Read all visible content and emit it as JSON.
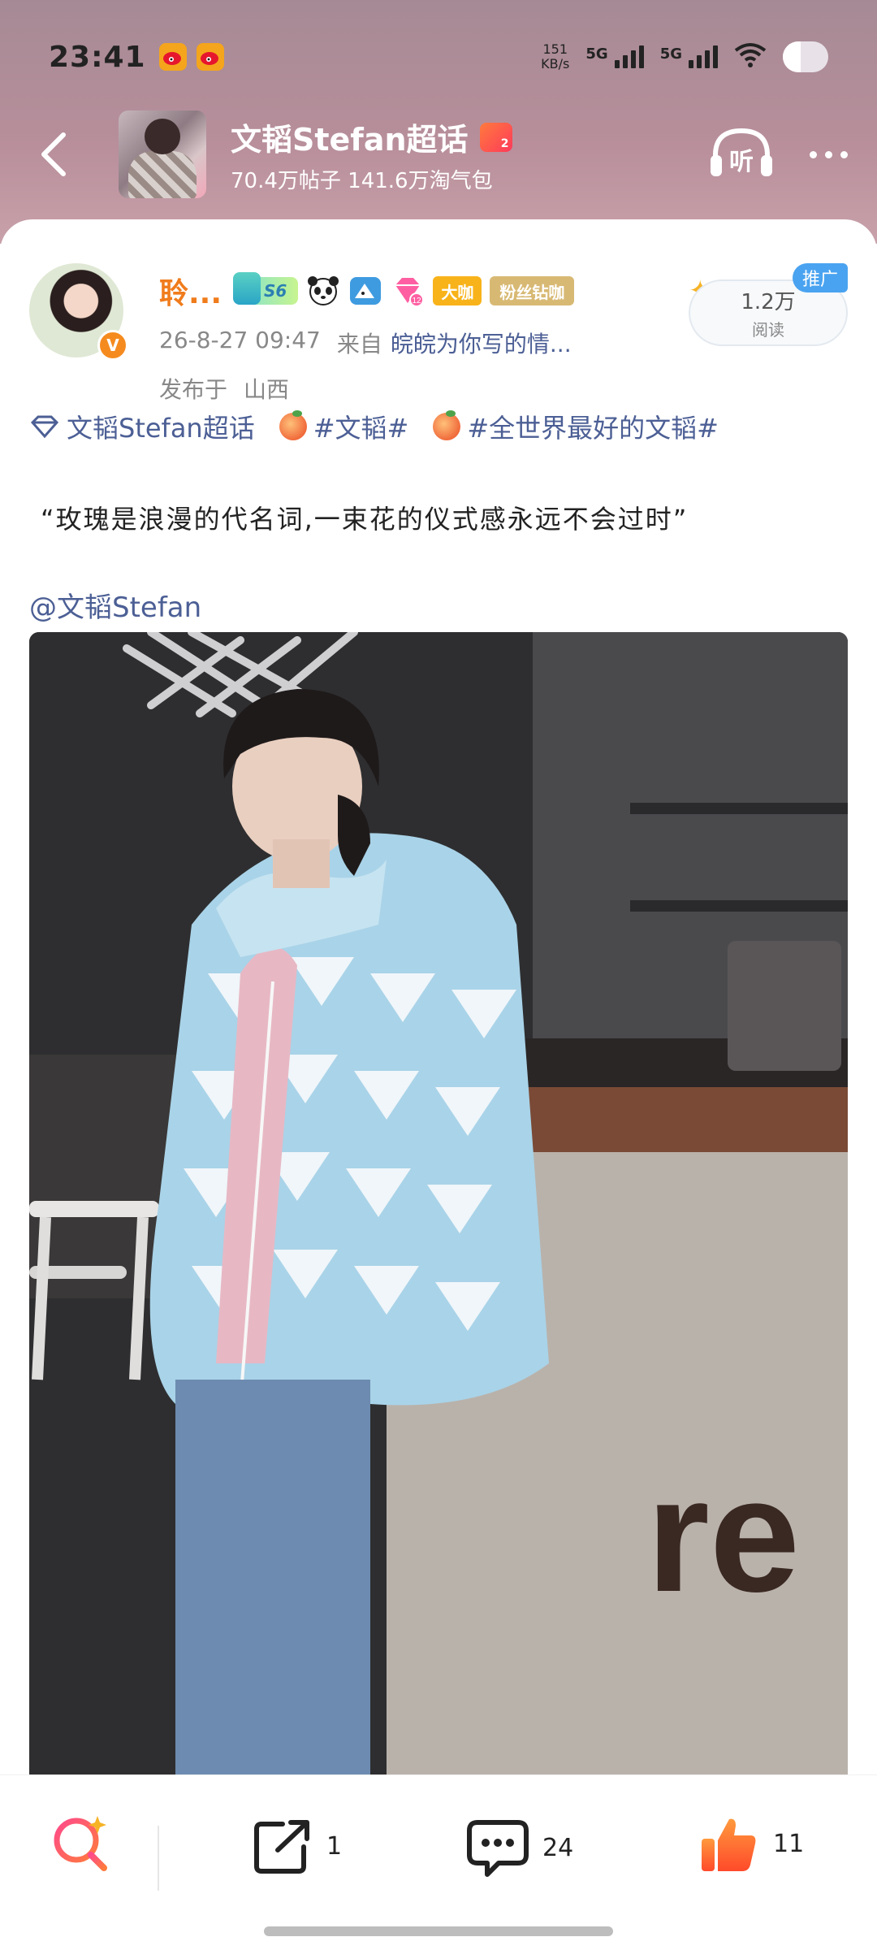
{
  "status_bar": {
    "time": "23:41",
    "net_speed_value": "151",
    "net_speed_unit": "KB/s",
    "signal1": "5G",
    "signal2": "5G",
    "notif_icons": [
      "weibo-icon",
      "weibo-icon"
    ]
  },
  "header": {
    "topic_title": "文韬Stefan超话",
    "topic_level": "2",
    "topic_stats": "70.4万帖子 141.6万淘气包",
    "listen_label": "听"
  },
  "post": {
    "username": "聆...",
    "badge_level": "S6",
    "badge_daka": "大咖",
    "badge_fan": "粉丝钻咖",
    "rank_badge_num": "12",
    "timestamp": "26-8-27 09:47",
    "source_prefix": "来自",
    "source_name": "皖皖为你写的情...",
    "location_prefix": "发布于",
    "location": "山西",
    "views_count": "1.2万",
    "views_label": "阅读",
    "promo_tag": "推广",
    "topic_links": [
      {
        "label": "文韬Stefan超话",
        "icon": "supertopic-diamond-icon"
      },
      {
        "label": "#文韬#",
        "icon": "peach-icon"
      },
      {
        "label": "#全世界最好的文韬#",
        "icon": "peach-icon"
      }
    ],
    "text": "“玫瑰是浪漫的代名词,一束花的仪式感永远不会过时”",
    "mention": "@文韬Stefan",
    "photo_sign_text": "re"
  },
  "actions": {
    "share_count": "1",
    "comment_count": "24",
    "like_count": "11"
  },
  "colors": {
    "accent_link": "#4c5f95",
    "username": "#f07c1c",
    "like": "#ff6a2a"
  }
}
